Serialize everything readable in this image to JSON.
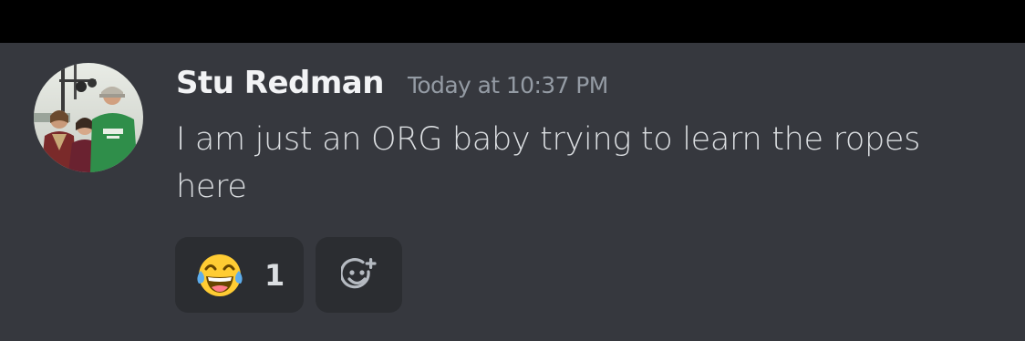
{
  "message": {
    "author": "Stu Redman",
    "timestamp": "Today at 10:37 PM",
    "content": "I am just an ORG baby trying to learn the ropes here",
    "avatar_icon": "user-avatar-photo",
    "reactions": [
      {
        "emoji_icon": "face-with-tears-of-joy-icon",
        "count": "1"
      }
    ],
    "add_reaction_icon": "add-reaction-icon"
  },
  "colors": {
    "background": "#36383e",
    "top_bar": "#000000",
    "username": "#f2f3f5",
    "timestamp": "#949ba4",
    "text": "#dbdee1",
    "reaction_bg": "#2b2d31"
  }
}
